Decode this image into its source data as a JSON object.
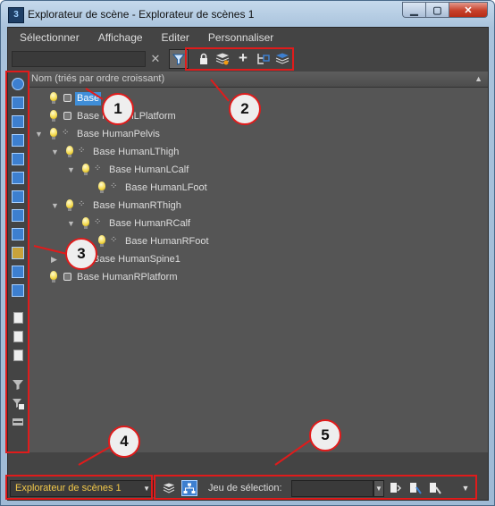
{
  "window": {
    "title": "Explorateur de scène - Explorateur de scènes 1",
    "app_icon_text": "3",
    "min_symbol": "▁",
    "max_symbol": "▢",
    "close_symbol": "✕"
  },
  "menu": [
    "Sélectionner",
    "Affichage",
    "Editer",
    "Personnaliser"
  ],
  "toolbar": {
    "search_value": "",
    "clear_icon": "✕",
    "filter_icon": "filter-icon"
  },
  "tree": {
    "header": "Nom (triés par ordre croissant)",
    "sort_symbol": "▲",
    "rows": [
      {
        "label": "Base HumanLPlatform",
        "visible_text": "Base",
        "selected": true
      },
      {
        "label": "Base HumanRPlatform",
        "visible_text": "Base HumanLPlatform",
        "selected": false
      },
      {
        "label": "Base HumanPelvis",
        "selected": false
      },
      {
        "label": "Base HumanLThigh",
        "selected": false
      },
      {
        "label": "Base HumanLCalf",
        "selected": false
      },
      {
        "label": "Base HumanLFoot",
        "selected": false
      },
      {
        "label": "Base HumanRThigh",
        "selected": false
      },
      {
        "label": "Base HumanRCalf",
        "selected": false
      },
      {
        "label": "Base HumanRFoot",
        "selected": false
      },
      {
        "label": "Base HumanSpine1",
        "selected": false
      },
      {
        "label": "Base HumanRPlatform",
        "selected": false
      }
    ]
  },
  "bottom": {
    "explorer_name": "Explorateur de scènes 1",
    "selection_label": "Jeu de sélection:",
    "selection_value": ""
  },
  "callouts": [
    "1",
    "2",
    "3",
    "4",
    "5"
  ],
  "colors": {
    "highlight": "#e01b1b",
    "selection": "#3f8ed8",
    "panel": "#444444",
    "explorer_name": "#f3c94a"
  }
}
